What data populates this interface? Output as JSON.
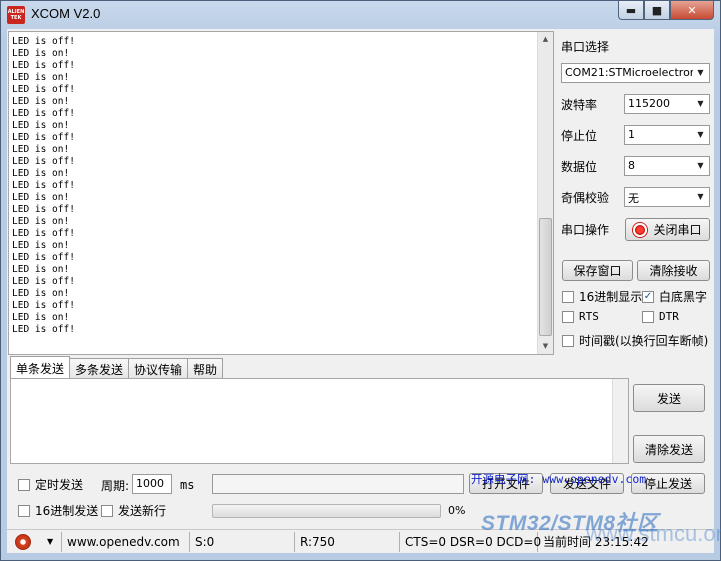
{
  "window": {
    "logo_text": "ALIEN TEK",
    "title": "XCOM V2.0",
    "minimize_glyph": "▬",
    "maximize_glyph": "■",
    "close_glyph": "✕"
  },
  "receive": {
    "lines": [
      "LED is off!",
      "LED is on!",
      "LED is off!",
      "LED is on!",
      "LED is off!",
      "LED is on!",
      "LED is off!",
      "LED is on!",
      "LED is off!",
      "LED is on!",
      "LED is off!",
      "LED is on!",
      "LED is off!",
      "LED is on!",
      "LED is off!",
      "LED is on!",
      "LED is off!",
      "LED is on!",
      "LED is off!",
      "LED is on!",
      "LED is off!",
      "LED is on!",
      "LED is off!",
      "LED is on!",
      "LED is off!"
    ]
  },
  "serial": {
    "port_select_label": "串口选择",
    "port_value": "COM21:STMicroelectron",
    "baud_label": "波特率",
    "baud_value": "115200",
    "stopbit_label": "停止位",
    "stopbit_value": "1",
    "databit_label": "数据位",
    "databit_value": "8",
    "parity_label": "奇偶校验",
    "parity_value": "无",
    "operate_label": "串口操作",
    "close_port_button": "关闭串口",
    "save_window_button": "保存窗口",
    "clear_receive_button": "清除接收",
    "hex_display_label": "16进制显示",
    "hex_display_checked": false,
    "white_bg_label": "白底黑字",
    "white_bg_checked": true,
    "rts_label": "RTS",
    "dtr_label": "DTR",
    "timestamp_label": "时间戳(以换行回车断帧)"
  },
  "tabs": [
    "单条发送",
    "多条发送",
    "协议传输",
    "帮助"
  ],
  "send": {
    "text": "",
    "send_button": "发送",
    "clear_send_button": "清除发送",
    "timed_send_label": "定时发送",
    "period_label": "周期:",
    "period_value": "1000",
    "period_unit": "ms",
    "hex_send_label": "16进制发送",
    "newline_label": "发送新行",
    "open_file_button": "打开文件",
    "send_file_button": "发送文件",
    "stop_send_button": "停止发送",
    "progress_percent": "0%",
    "progress_value": 0,
    "link_text": "开源电子网: www.openedv.com"
  },
  "status": {
    "website": "www.openedv.com",
    "sent": "S:0",
    "received": "R:750",
    "lines": "CTS=0 DSR=0 DCD=0",
    "time": "当前时间 23:15:42"
  },
  "watermark": {
    "line1": "STM32/STM8社区",
    "line2": "www.stmcu.org"
  },
  "colors": {
    "link": "#1426c8",
    "close_lamp": "#ff3b2f",
    "titlebar": "#c9d9ec"
  }
}
